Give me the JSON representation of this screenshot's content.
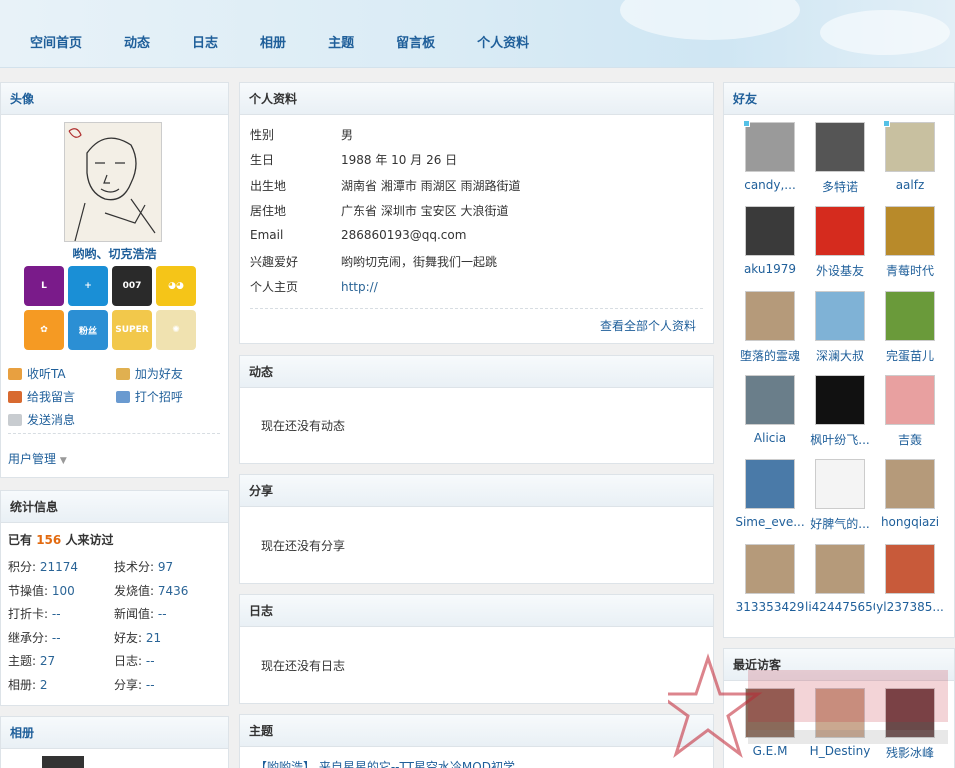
{
  "nav": [
    "空间首页",
    "动态",
    "日志",
    "相册",
    "主题",
    "留言板",
    "个人资料"
  ],
  "left": {
    "avatar_title": "头像",
    "user_name": "哟哟、切克浩浩",
    "badges": [
      {
        "label": "L",
        "color": "#7a1b8a"
      },
      {
        "label": "+",
        "color": "#1a8fd6"
      },
      {
        "label": "007",
        "color": "#2a2a2a"
      },
      {
        "label": "◕◕",
        "color": "#f5c518"
      },
      {
        "label": "✿",
        "color": "#f59a23"
      },
      {
        "label": "粉丝",
        "color": "#2b8fd4"
      },
      {
        "label": "SUPER",
        "color": "#f2c84b"
      },
      {
        "label": "✺",
        "color": "#f0e2b0"
      }
    ],
    "actions": [
      "收听TA",
      "加为好友",
      "给我留言",
      "打个招呼",
      "发送消息"
    ],
    "user_manage": "用户管理",
    "stats_title": "统计信息",
    "visits_prefix": "已有",
    "visits_count": "156",
    "visits_suffix": "人来访过",
    "stats": [
      [
        "积分:",
        "21174",
        "技术分:",
        "97"
      ],
      [
        "节操值:",
        "100",
        "发烧值:",
        "7436"
      ],
      [
        "打折卡:",
        "--",
        "新闻值:",
        "--"
      ],
      [
        "继承分:",
        "--",
        "好友:",
        "21"
      ],
      [
        "主题:",
        "27",
        "日志:",
        "--"
      ],
      [
        "相册:",
        "2",
        "分享:",
        "--"
      ]
    ],
    "album_title": "相册"
  },
  "center": {
    "profile_title": "个人资料",
    "profile": [
      [
        "性别",
        "男"
      ],
      [
        "生日",
        "1988 年 10 月 26 日"
      ],
      [
        "出生地",
        "湖南省 湘潭市 雨湖区 雨湖路街道"
      ],
      [
        "居住地",
        "广东省 深圳市 宝安区 大浪街道"
      ],
      [
        "Email",
        "286860193@qq.com"
      ],
      [
        "兴趣爱好",
        "哟哟切克闹，街舞我们一起跳"
      ],
      [
        "个人主页",
        "http://"
      ]
    ],
    "view_all": "查看全部个人资料",
    "feed_title": "动态",
    "feed_empty": "现在还没有动态",
    "share_title": "分享",
    "share_empty": "现在还没有分享",
    "blog_title": "日志",
    "blog_empty": "现在还没有日志",
    "topic_title": "主题",
    "topic_first": "【哟哟浩】 来自星星的它--TT星空水冷MOD初学"
  },
  "right": {
    "friends_title": "好友",
    "friends": [
      {
        "name": "candy,...",
        "color": "#9a9a9a",
        "online": true
      },
      {
        "name": "多特诺",
        "color": "#555555",
        "online": false
      },
      {
        "name": "aalfz",
        "color": "#c8c0a0",
        "online": true
      },
      {
        "name": "aku1979",
        "color": "#3a3a3a",
        "online": false
      },
      {
        "name": "外设基友",
        "color": "#d52b1e",
        "online": false
      },
      {
        "name": "青莓时代",
        "color": "#b88a2a",
        "online": false
      },
      {
        "name": "堕落的霊魂",
        "color": "#b59a7a",
        "online": false
      },
      {
        "name": "深澜大叔",
        "color": "#7fb2d6",
        "online": false
      },
      {
        "name": "完蛋苗儿",
        "color": "#6a9a3a",
        "online": false
      },
      {
        "name": "Alicia",
        "color": "#6a7e8a",
        "online": false
      },
      {
        "name": "枫叶纷飞...",
        "color": "#111111",
        "online": false
      },
      {
        "name": "吉轰",
        "color": "#e8a0a0",
        "online": false
      },
      {
        "name": "Sime_eve...",
        "color": "#4a7aa8",
        "online": false
      },
      {
        "name": "好脾气的...",
        "color": "#f4f4f4",
        "online": false
      },
      {
        "name": "hongqiazi",
        "color": "#b59a7a",
        "online": false
      },
      {
        "name": "313353429",
        "color": "#b59a7a",
        "online": false
      },
      {
        "name": "li424475650",
        "color": "#b59a7a",
        "online": false
      },
      {
        "name": "yl237385...",
        "color": "#c85a3a",
        "online": false
      }
    ],
    "visitors_title": "最近访客",
    "visitors": [
      {
        "name": "G.E.M",
        "color": "#8a6a5a"
      },
      {
        "name": "H_Destiny",
        "color": "#caa890"
      },
      {
        "name": "残影冰峰",
        "color": "#6a4a4a"
      }
    ]
  }
}
